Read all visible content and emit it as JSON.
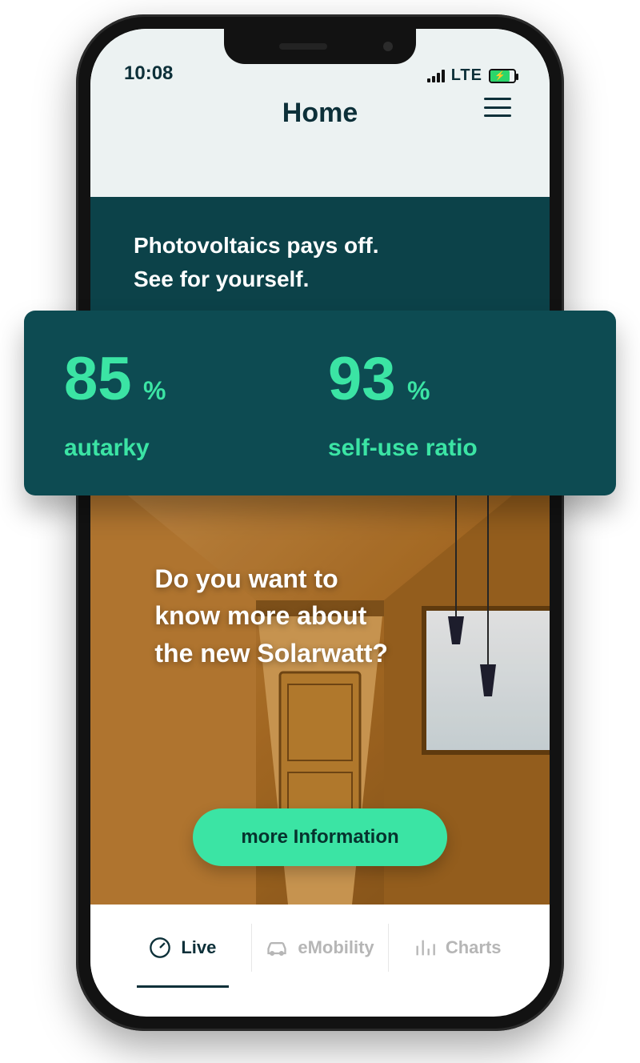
{
  "colors": {
    "dark_teal": "#0c4249",
    "mint": "#3be4a4",
    "header_bg": "#ecf2f2",
    "ink": "#0d3039",
    "grey": "#b6b6b6"
  },
  "status_bar": {
    "time": "10:08",
    "network": "LTE"
  },
  "header": {
    "title": "Home"
  },
  "intro": {
    "line1": "Photovoltaics pays off.",
    "line2": "See for yourself."
  },
  "stats": [
    {
      "value": "85",
      "unit": "%",
      "label": "autarky"
    },
    {
      "value": "93",
      "unit": "%",
      "label": "self-use ratio"
    }
  ],
  "hero": {
    "headline_l1": "Do you want to",
    "headline_l2": "know more about",
    "headline_l3": "the new Solarwatt?",
    "cta": "more Information"
  },
  "tabs": [
    {
      "icon": "gauge-icon",
      "label": "Live",
      "active": true
    },
    {
      "icon": "car-icon",
      "label": "eMobility",
      "active": false
    },
    {
      "icon": "barchart-icon",
      "label": "Charts",
      "active": false
    }
  ]
}
